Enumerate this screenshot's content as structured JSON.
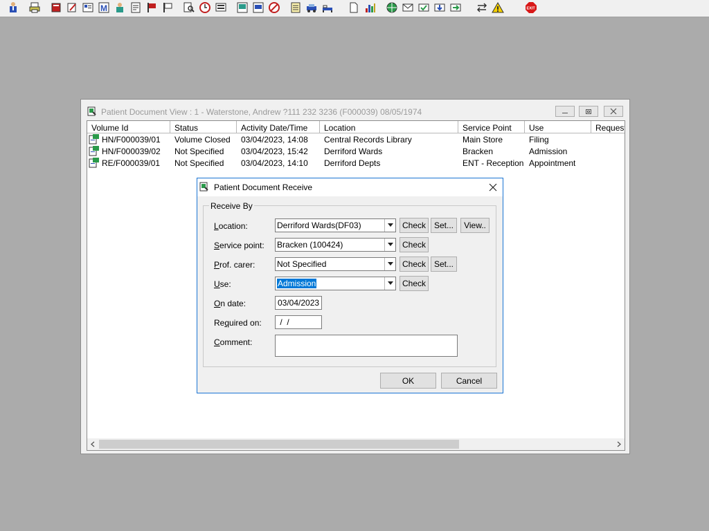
{
  "toolbar": {
    "icons": [
      "patient-icon",
      "printer-icon",
      "book-icon",
      "edit-icon",
      "card-icon",
      "m-icon",
      "doctor-icon",
      "notes-icon",
      "flag-icon",
      "flag2-icon",
      "search-doc-icon",
      "clock-icon",
      "screen-icon",
      "monitor-icon",
      "chat-icon",
      "no-icon",
      "notepad-icon",
      "car-icon",
      "bed-icon",
      "document-icon",
      "bar-chart-icon",
      "globe-icon",
      "mail-icon",
      "mail-check-icon",
      "mail-down-icon",
      "mail-arrow-icon",
      "swap-icon",
      "warning-icon",
      "exit-icon"
    ],
    "exit_label": "EXIT"
  },
  "window": {
    "title": "Patient Document View : 1 - Waterstone, Andrew ?111 232 3236 (F000039) 08/05/1974",
    "columns": [
      "Volume Id",
      "Status",
      "Activity Date/Time",
      "Location",
      "Service Point",
      "Use",
      "Requeste"
    ],
    "rows": [
      [
        "HN/F000039/01",
        "Volume Closed",
        "03/04/2023, 14:08",
        "Central Records Library",
        "Main Store",
        "Filing",
        ""
      ],
      [
        "HN/F000039/02",
        "Not Specified",
        "03/04/2023, 15:42",
        "Derriford Wards",
        "Bracken",
        "Admission",
        ""
      ],
      [
        "RE/F000039/01",
        "Not Specified",
        "03/04/2023, 14:10",
        "Derriford Depts",
        "ENT - Reception",
        "Appointment",
        ""
      ]
    ]
  },
  "dialog": {
    "title": "Patient Document Receive",
    "group_label": "Receive By",
    "location": {
      "label_u": "L",
      "label_rest": "ocation:",
      "value": "Derriford Wards(DF03)"
    },
    "service_point": {
      "label_u": "S",
      "label_rest": "ervice point:",
      "value": "Bracken (100424)"
    },
    "prof_carer": {
      "label_u": "P",
      "label_rest": "rof. carer:",
      "value": "Not Specified"
    },
    "use": {
      "label_u": "U",
      "label_rest": "se:",
      "value": "Admission"
    },
    "on_date": {
      "label_u": "O",
      "label_rest": "n date:",
      "value": "03/04/2023"
    },
    "required_on": {
      "label_pre": "Re",
      "label_u": "q",
      "label_rest": "uired on:",
      "value": " /  /"
    },
    "comment": {
      "label_u": "C",
      "label_rest": "omment:",
      "value": ""
    },
    "buttons": {
      "check": "Check",
      "set": "Set...",
      "view": "View..",
      "ok": "OK",
      "cancel": "Cancel"
    }
  }
}
